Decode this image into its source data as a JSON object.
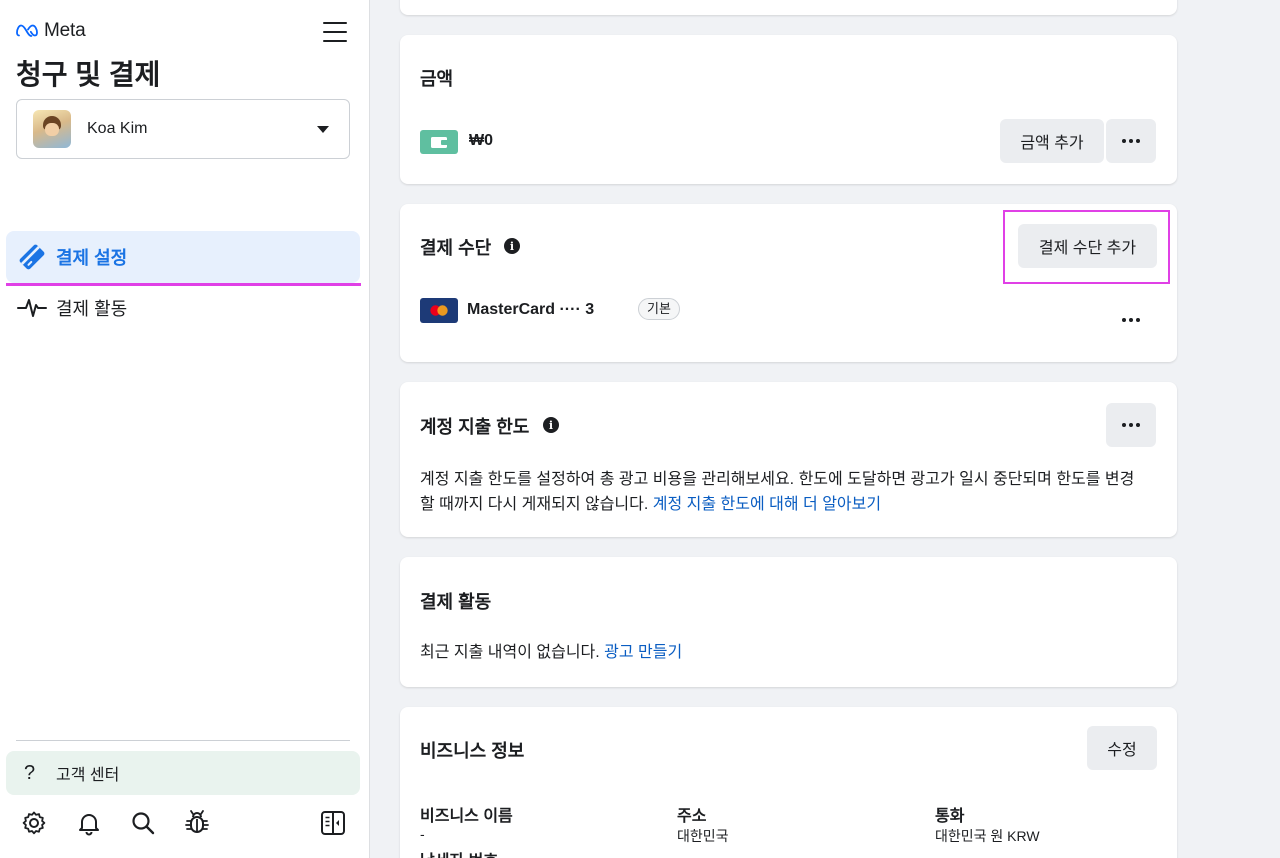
{
  "sidebar": {
    "brand": "Meta",
    "page_title": "청구 및 결제",
    "account": {
      "name": "Koa Kim"
    },
    "nav": [
      {
        "label": "결제 설정",
        "icon": "credit-card-icon",
        "active": true
      },
      {
        "label": "결제 활동",
        "icon": "activity-icon",
        "active": false
      }
    ],
    "help": {
      "icon": "question-icon",
      "label": "고객 센터"
    },
    "toolbar": [
      "gear-icon",
      "bell-icon",
      "search-icon",
      "bug-icon",
      "panel-toggle-icon"
    ]
  },
  "balance": {
    "title": "금액",
    "amount": "₩0",
    "add_label": "금액 추가"
  },
  "payment_methods": {
    "title": "결제 수단",
    "add_label": "결제 수단 추가",
    "card": {
      "name": "MasterCard ···· 3",
      "badge": "기본"
    }
  },
  "spending_limit": {
    "title": "계정 지출 한도",
    "description_line1": "계정 지출 한도를 설정하여 총 광고 비용을 관리해보세요. 한도에 도달하면 광고가 일시 중단되며 한도를 변경",
    "description_line2": "할 때까지 다시 게재되지 않습니다.",
    "learn_more": "계정 지출 한도에 대해 더 알아보기"
  },
  "payment_activity": {
    "title": "결제 활동",
    "empty_text": "최근 지출 내역이 없습니다.",
    "create_ad": "광고 만들기"
  },
  "business_info": {
    "title": "비즈니스 정보",
    "edit_label": "수정",
    "fields": [
      {
        "label": "비즈니스 이름",
        "value": "-"
      },
      {
        "label": "주소",
        "value": "대한민국"
      },
      {
        "label": "통화",
        "value": "대한민국 원 KRW"
      }
    ],
    "next_label": "납세자 번호"
  },
  "colors": {
    "accent": "#1b74e4",
    "link": "#0a5dc2",
    "highlight": "#e040e6",
    "help_bg": "#e9f3ee"
  }
}
